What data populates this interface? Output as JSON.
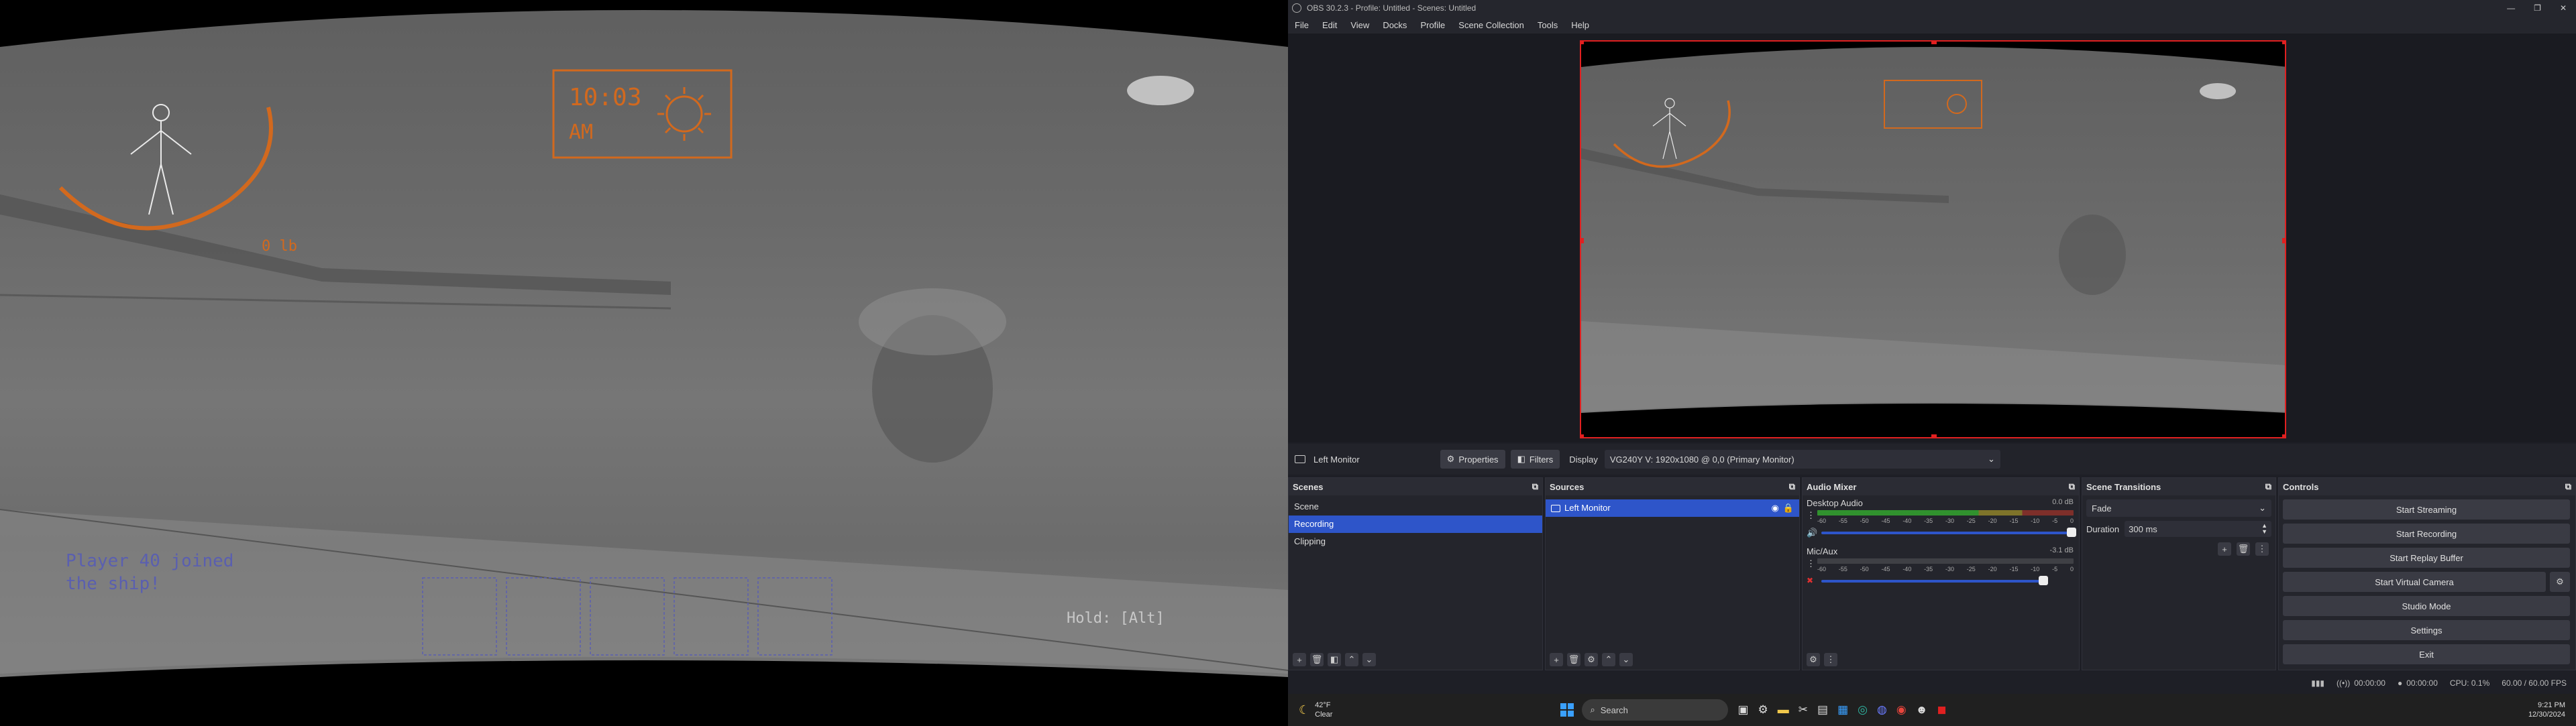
{
  "game": {
    "clock_time": "10:03",
    "clock_ampm": "AM",
    "weight_text": "0 lb",
    "message_line1": "Player 40 joined",
    "message_line2": "the ship!",
    "hold_prompt": "Hold: [Alt]"
  },
  "obs": {
    "window_title": "OBS 30.2.3 - Profile: Untitled - Scenes: Untitled",
    "menu": [
      "File",
      "Edit",
      "View",
      "Docks",
      "Profile",
      "Scene Collection",
      "Tools",
      "Help"
    ],
    "source_toolbar": {
      "source_name": "Left Monitor",
      "properties_label": "Properties",
      "filters_label": "Filters",
      "display_label": "Display",
      "display_value": "VG240Y V: 1920x1080 @ 0,0 (Primary Monitor)"
    },
    "scenes": {
      "title": "Scenes",
      "items": [
        "Scene",
        "Recording",
        "Clipping"
      ],
      "selected": "Recording"
    },
    "sources": {
      "title": "Sources",
      "items": [
        "Left Monitor"
      ]
    },
    "audio_mixer": {
      "title": "Audio Mixer",
      "channels": [
        {
          "name": "Desktop Audio",
          "db": "0.0 dB",
          "level": 0.62
        },
        {
          "name": "Mic/Aux",
          "db": "-3.1 dB",
          "level": 0.0
        }
      ],
      "ticks": [
        "-60",
        "-55",
        "-50",
        "-45",
        "-40",
        "-35",
        "-30",
        "-25",
        "-20",
        "-15",
        "-10",
        "-5",
        "0"
      ]
    },
    "scene_transitions": {
      "title": "Scene Transitions",
      "transition": "Fade",
      "duration_label": "Duration",
      "duration_value": "300 ms"
    },
    "controls": {
      "title": "Controls",
      "buttons": [
        "Start Streaming",
        "Start Recording",
        "Start Replay Buffer",
        "Start Virtual Camera",
        "Studio Mode",
        "Settings",
        "Exit"
      ]
    },
    "status": {
      "stream_time": "00:00:00",
      "rec_time": "00:00:00",
      "cpu": "CPU: 0.1%",
      "fps": "60.00 / 60.00 FPS"
    }
  },
  "taskbar": {
    "weather_temp": "42°F",
    "weather_desc": "Clear",
    "search_placeholder": "Search",
    "time": "9:21 PM",
    "date": "12/30/2024"
  },
  "colors": {
    "hud_orange": "#d2691e",
    "hud_blue": "#5a5fb0",
    "obs_selection": "#2e55c9",
    "preview_border": "#e02020"
  }
}
